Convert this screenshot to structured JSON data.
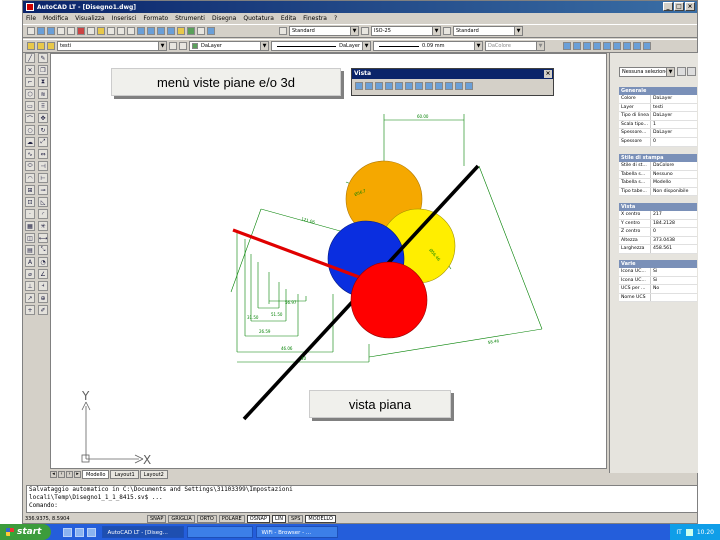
{
  "window": {
    "title": "AutoCAD LT - [Disegno1.dwg]",
    "controls": [
      "_",
      "□",
      "×"
    ]
  },
  "menu": [
    "File",
    "Modifica",
    "Visualizza",
    "Inserisci",
    "Formato",
    "Strumenti",
    "Disegna",
    "Quotatura",
    "Edita",
    "Finestra",
    "?"
  ],
  "toolbar2": {
    "text_style": "Standard",
    "dim_style": "ISO-25",
    "table_style": "Standard"
  },
  "toolbar3": {
    "layer": "testi",
    "color": "DaLayer",
    "linetype": "DaLayer",
    "lineweight": "0.09 mm",
    "plotstyle": "DaColore"
  },
  "labels": {
    "menu_label": "menù viste piane e/o 3d",
    "view_label": "vista piana"
  },
  "view_toolbar": {
    "title": "Vista",
    "close": "×"
  },
  "drawing": {
    "dims": [
      "60.00",
      "Ø56.7",
      "Ø56.46",
      "58.46",
      "121.06",
      "56.97",
      "51.50",
      "26.59",
      "31.50",
      "46.06",
      "40"
    ],
    "axis_x": "X",
    "axis_y": "Y",
    "colors": {
      "orange": "#f5a800",
      "yellow": "#ffee00",
      "blue": "#0a2ee0",
      "red": "#ff0000",
      "dim": "#008000"
    }
  },
  "tabs": [
    "Modello",
    "Layout1",
    "Layout2"
  ],
  "props": {
    "selector": "Nessuna selezione",
    "sections": [
      {
        "title": "Generale",
        "rows": [
          [
            "Colore",
            "DaLayer"
          ],
          [
            "Layer",
            "testi"
          ],
          [
            "Tipo di linea",
            "DaLayer"
          ],
          [
            "Scala tipo...",
            "1"
          ],
          [
            "Spessore...",
            "DaLayer"
          ],
          [
            "Spessore",
            "0"
          ]
        ]
      },
      {
        "title": "Stile di stampa",
        "rows": [
          [
            "Stile di st...",
            "DaColore"
          ],
          [
            "Tabella s...",
            "Nessuno"
          ],
          [
            "Tabella s...",
            "Modello"
          ],
          [
            "Tipo tabe...",
            "Non disponibile"
          ]
        ]
      },
      {
        "title": "Vista",
        "rows": [
          [
            "X centro",
            "217"
          ],
          [
            "Y centro",
            "184.2128"
          ],
          [
            "Z centro",
            "0"
          ],
          [
            "Altezza",
            "373.0438"
          ],
          [
            "Larghezza",
            "458.561"
          ]
        ]
      },
      {
        "title": "Varie",
        "rows": [
          [
            "Icona UC...",
            "Sì"
          ],
          [
            "Icona UC...",
            "Sì"
          ],
          [
            "UCS per ...",
            "No"
          ],
          [
            "Nome UCS",
            ""
          ]
        ]
      }
    ]
  },
  "command": [
    "Salvataggio automatico in C:\\Documents and Settings\\31103399\\Impostazioni",
    "locali\\Temp\\Disegno1_1_1_8415.sv$ ...",
    "Comando:"
  ],
  "status": {
    "coords": "336.9375, 8.5904",
    "buttons": [
      "SNAP",
      "GRIGLIA",
      "ORTO",
      "POLARE",
      "OSNAP",
      "LIN",
      "SPS",
      "MODELLO"
    ],
    "on": [
      4,
      5,
      7
    ]
  },
  "taskbar": {
    "start": "start",
    "tasks": [
      "AutoCAD LT - [Diseg...",
      "",
      "WiFi - Browser - ..."
    ],
    "lang": "IT",
    "clock": "10.20"
  }
}
